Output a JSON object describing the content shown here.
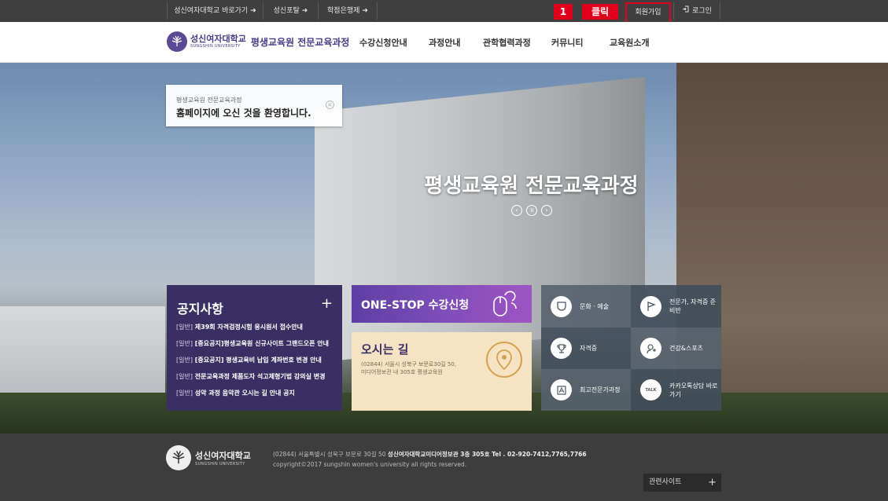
{
  "topbar": {
    "links": [
      {
        "label": "성신여자대학교 바로가기"
      },
      {
        "label": "성신포탈"
      },
      {
        "label": "학점은행제"
      }
    ],
    "arrow": "➜",
    "signup_label": "회원가입",
    "login_label": "로그인",
    "annotation_number": "1",
    "annotation_text": "클릭"
  },
  "header": {
    "univ_kr": "성신여자대학교",
    "univ_en": "SUNGSHIN UNIVERSITY",
    "site_title": "평생교육원 전문교육과정",
    "nav": [
      "수강신청안내",
      "과정안내",
      "관학협력과정",
      "커뮤니티",
      "교육원소개"
    ]
  },
  "welcome": {
    "sub": "평생교육원 전문교육과정",
    "main": "홈페이지에 오신 것을 환영합니다.",
    "close": "×"
  },
  "hero": {
    "title": "평생교육원 전문교육과정",
    "controls": [
      "‹",
      "॥",
      "›"
    ]
  },
  "notice": {
    "title": "공지사항",
    "plus": "+",
    "items": [
      {
        "tag": "[일반]",
        "text": "제39회 자격검정시험 응시원서 접수안내"
      },
      {
        "tag": "[일반]",
        "text": "[중요공지]평생교육원 신규사이트 그랜드오픈 안내"
      },
      {
        "tag": "[일반]",
        "text": "[중요공지] 평생교육비 납입 계좌번호 변경 안내"
      },
      {
        "tag": "[일반]",
        "text": "전문교육과정 제품도자 석고제형기법 강의실 변경"
      },
      {
        "tag": "[일반]",
        "text": "성악 과정 음악관 오시는 길 안내 공지"
      }
    ]
  },
  "onestop": {
    "title": "ONE-STOP 수강신청"
  },
  "direction": {
    "title": "오시는 길",
    "address": "(02844) 서울시 성북구 보문로30길 50, 미디어정보관 내 305호 평생교육원"
  },
  "quick": [
    {
      "label": "문화 · 예술",
      "icon": "mask-icon"
    },
    {
      "label": "전문가, 자격증 준비반",
      "icon": "flag-icon"
    },
    {
      "label": "자격증",
      "icon": "trophy-icon"
    },
    {
      "label": "건강&스포츠",
      "icon": "health-icon"
    },
    {
      "label": "최고전문가과정",
      "icon": "certificate-icon"
    },
    {
      "label": "카카오톡상담 바로가기",
      "icon": "kakaotalk-icon"
    }
  ],
  "quick_icon_text": {
    "kakao": "TALK"
  },
  "footer": {
    "univ_kr": "성신여자대학교",
    "univ_en": "SUNGSHIN UNIVERSITY",
    "address_prefix": "(02844) 서울특별시 성북구 보문로 30길 50",
    "address_bold": "성신여자대학교미디어정보관 3층 305호 Tel . 02-920-7412,7765,7766",
    "copyright": "copyright©2017 sungshin women's university all rights reserved.",
    "related_label": "관련사이트",
    "related_plus": "+"
  }
}
